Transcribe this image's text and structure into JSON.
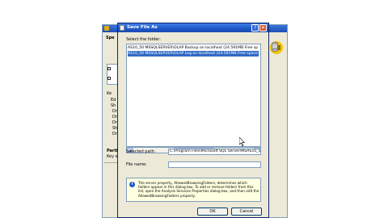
{
  "background_window": {
    "header_text": "Spe",
    "side_labels": [
      "Ke",
      "Ed",
      "Sh",
      "Dri",
      "Dri",
      "Dri",
      "Sh",
      "Dri",
      "Parti",
      "Key e"
    ]
  },
  "dialog": {
    "title": "Save File As",
    "help_glyph": "?",
    "close_glyph": "✕",
    "select_folder_label": "Select the folder:",
    "folders": [
      "AS10_50 MSSQLSERVER\\OLAP Backup on localhost (24.591MB Free sp",
      "AS10_50 MSSQLSERVER\\OLAP Log on localhost (24.591MB Free space"
    ],
    "selected_index": 1,
    "selected_path_label": "Selected path:",
    "selected_path_value": "C:\\Program Files\\Microsoft SQL Server\\MSAS10_5",
    "file_name_label": "File name:",
    "file_name_value": "",
    "info_text": "The server property, AllowedBrowsingFolders, determines which folders appear in this dialog box. To add or remove folders from this list, open the Analysis Services Properties dialog box, and then edit the AllowedBrowsingFolders property.",
    "ok_label": "OK",
    "cancel_label": "Cancel"
  },
  "icons": {
    "dialog_icon": "document-icon",
    "info_icon": "info-icon",
    "scroll_left": "arrow-left-icon",
    "scroll_right": "arrow-right-icon",
    "database": "database-icon",
    "cursor": "mouse-cursor-icon"
  },
  "colors": {
    "titlebar": "#1e58c8",
    "selection": "#316ac5",
    "dialog_bg": "#ece9d8",
    "info_bg": "#ffffe1"
  }
}
